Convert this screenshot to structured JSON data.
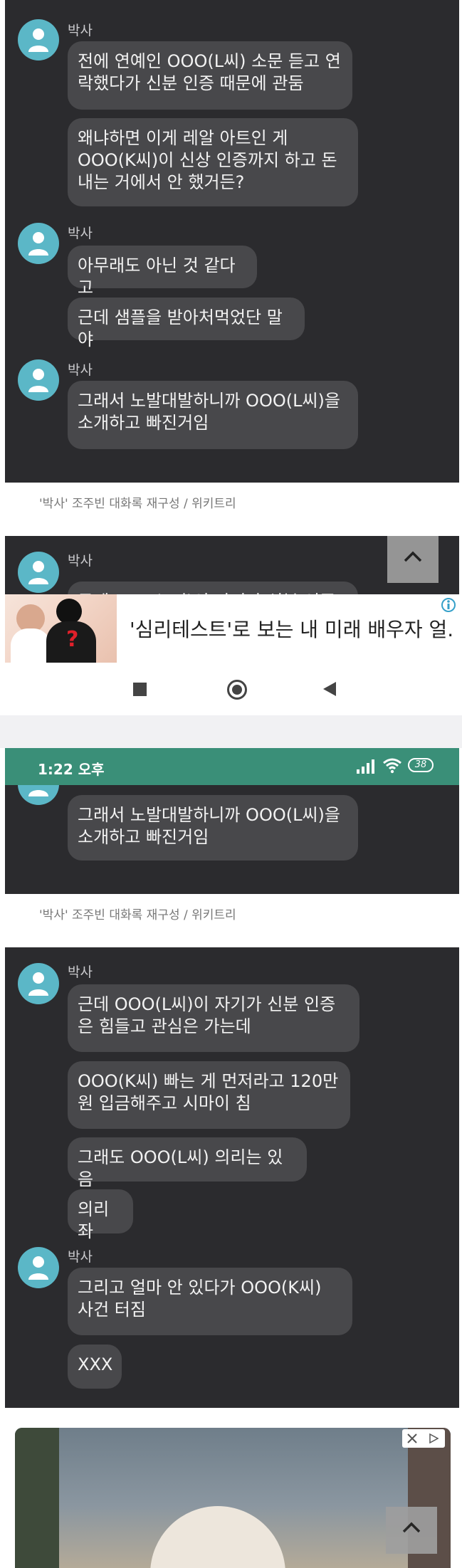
{
  "sender_name": "박사",
  "messages_block1": [
    "전에 연예인 OOO(L씨) 소문 듣고 연락했다가 신분 인증 때문에 관둠",
    "왜냐하면 이게 레알 아트인 게 OOO(K씨)이 신상 인증까지 하고 돈 내는 거에서 안 했거든?",
    "아무래도 아닌 것 같다고",
    "근데 샘플을 받아처먹었단 말야",
    "그래서 노발대발하니까 OOO(L씨)을 소개하고 빠진거임"
  ],
  "caption": "'박사' 조주빈 대화록 재구성 / 위키트리",
  "partial_message": "근데 OOO(L씨)이 자기가 신분 인증은",
  "ad": {
    "title": "'심리테스트'로 보는 내 미래 배우자 얼...",
    "badge_icon": "adchoices-icon"
  },
  "navbar": {
    "recent_icon": "square-icon",
    "home_icon": "circle-icon",
    "back_icon": "triangle-left-icon"
  },
  "statusbar": {
    "time": "1:22 오후",
    "battery": "38",
    "accent_color": "#3a8f78"
  },
  "messages_block2_top": "그래서 노발대발하니까 OOO(L씨)을 소개하고 빠진거임",
  "messages_block3": [
    "근데 OOO(L씨)이 자기가 신분 인증은 힘들고 관심은 가는데",
    "OOO(K씨) 빠는 게 먼저라고 120만원 입금해주고 시마이 침",
    "그래도 OOO(L씨) 의리는 있음",
    "의리좌",
    "그리고 얼마 안 있다가 OOO(K씨) 사건 터짐",
    "XXX"
  ]
}
